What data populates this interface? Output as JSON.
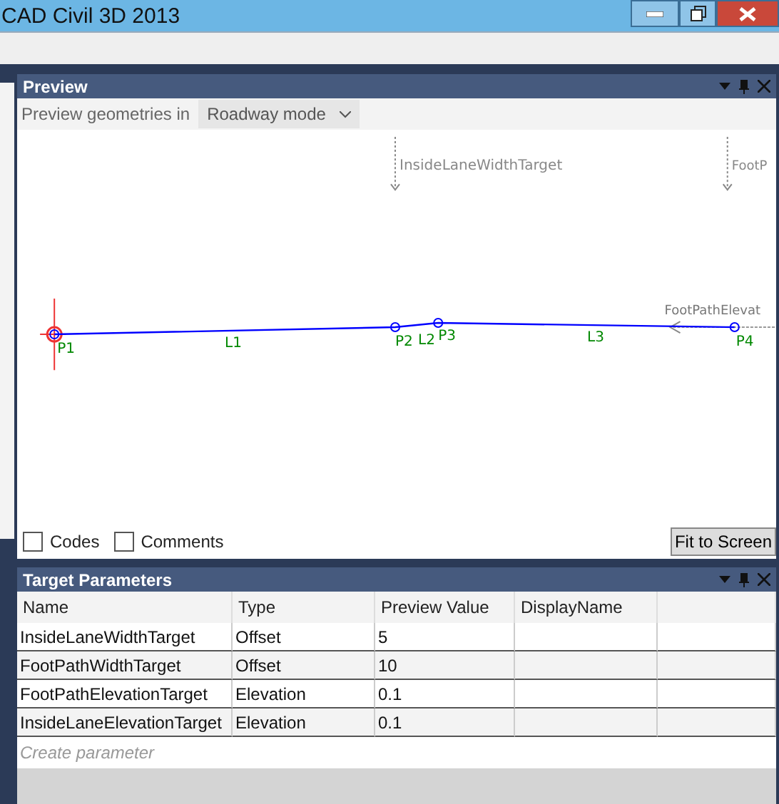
{
  "window": {
    "title": "CAD Civil 3D 2013"
  },
  "preview": {
    "title": "Preview",
    "mode_label": "Preview geometries in",
    "mode": "Roadway mode",
    "targets": [
      {
        "label": "InsideLaneWidthTarget",
        "kind": "width"
      },
      {
        "label": "FootP",
        "kind": "width"
      }
    ],
    "elevation_labels": [
      "FootPathElevat"
    ],
    "points": [
      "P1",
      "P2",
      "P3",
      "P4"
    ],
    "links": [
      "L1",
      "L2",
      "L3"
    ],
    "options": [
      {
        "label": "Codes",
        "checked": false
      },
      {
        "label": "Comments",
        "checked": false
      }
    ],
    "fit_button": "Fit to Screen"
  },
  "target_parameters": {
    "title": "Target Parameters",
    "columns": [
      "Name",
      "Type",
      "Preview Value",
      "DisplayName"
    ],
    "rows": [
      [
        "InsideLaneWidthTarget",
        "Offset",
        "5",
        ""
      ],
      [
        "FootPathWidthTarget",
        "Offset",
        "10",
        ""
      ],
      [
        "FootPathElevationTarget",
        "Elevation",
        "0.1",
        ""
      ],
      [
        "InsideLaneElevationTarget",
        "Elevation",
        "0.1",
        ""
      ]
    ],
    "placeholder": "Create parameter"
  }
}
